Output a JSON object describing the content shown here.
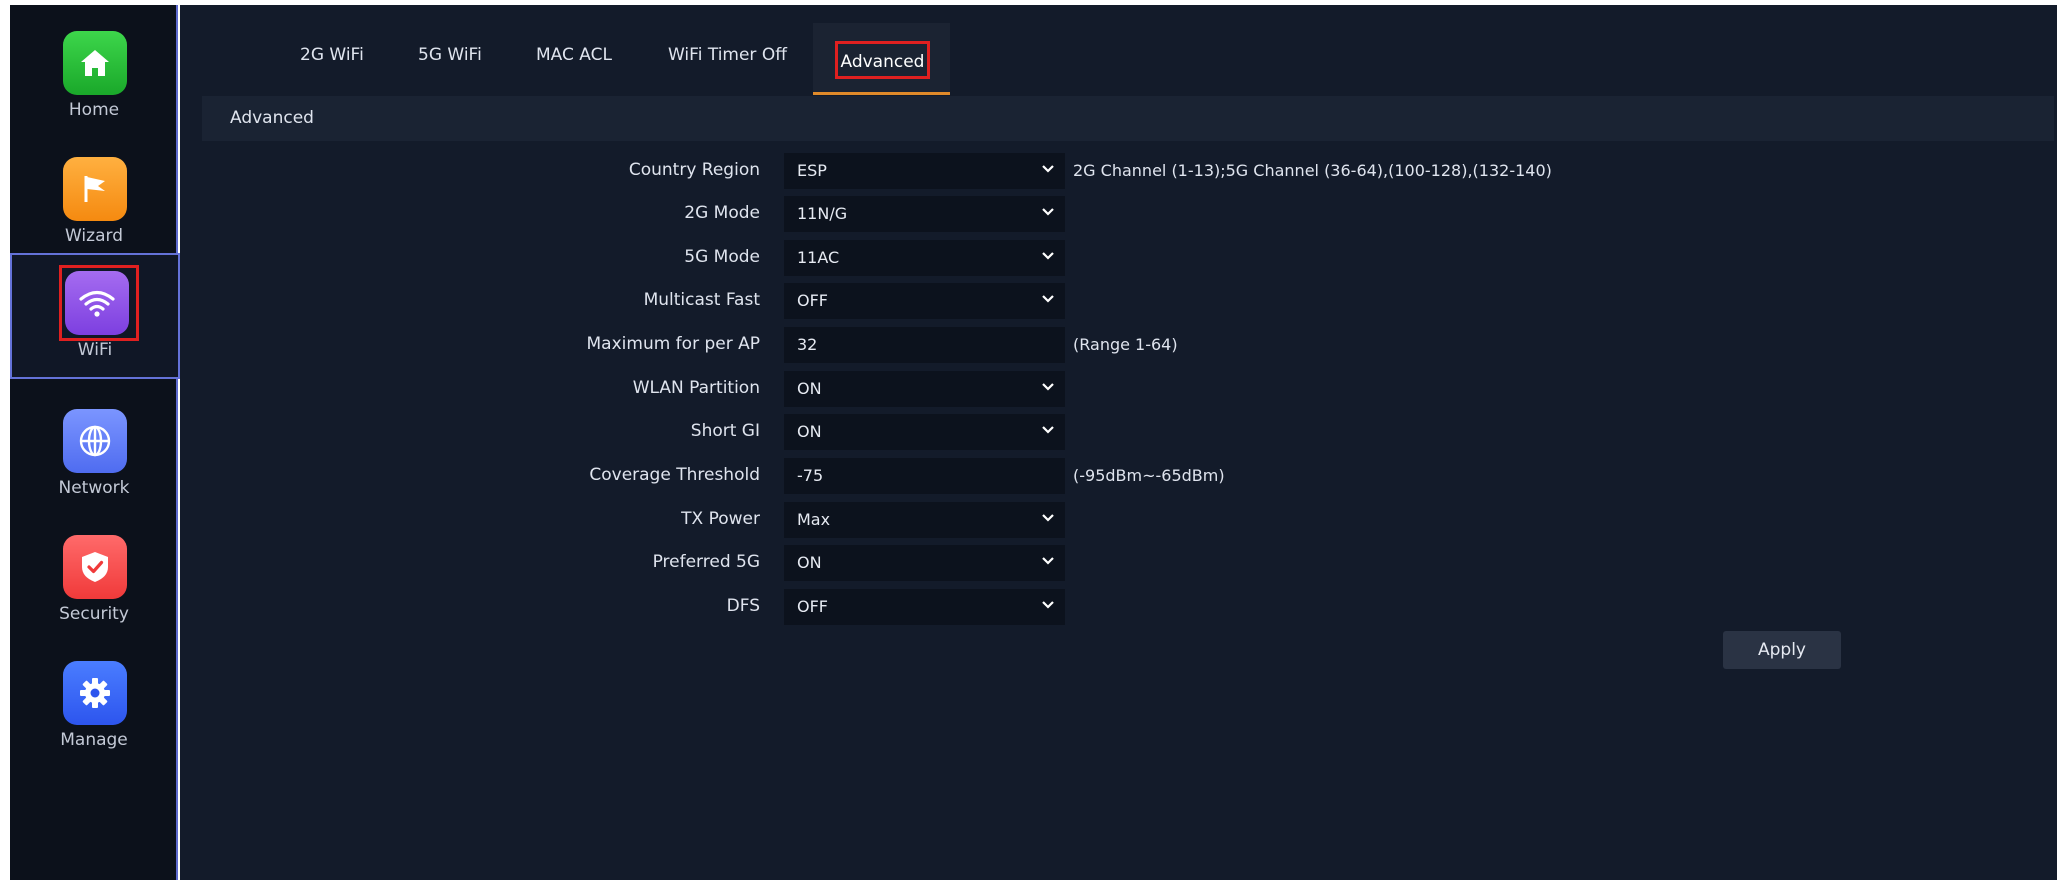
{
  "sidebar": {
    "items": [
      {
        "label": "Home",
        "icon": "home-icon"
      },
      {
        "label": "Wizard",
        "icon": "flag-icon"
      },
      {
        "label": "WiFi",
        "icon": "wifi-icon"
      },
      {
        "label": "Network",
        "icon": "globe-icon"
      },
      {
        "label": "Security",
        "icon": "shield-icon"
      },
      {
        "label": "Manage",
        "icon": "gear-icon"
      }
    ],
    "active": "WiFi"
  },
  "tabs": {
    "items": [
      "2G WiFi",
      "5G WiFi",
      "MAC ACL",
      "WiFi Timer Off",
      "Advanced"
    ],
    "active": "Advanced"
  },
  "section": {
    "title": "Advanced"
  },
  "form": {
    "rows": [
      {
        "label": "Country Region",
        "value": "ESP",
        "type": "select",
        "hint": "2G Channel (1-13);5G Channel (36-64),(100-128),(132-140)"
      },
      {
        "label": "2G Mode",
        "value": "11N/G",
        "type": "select",
        "hint": ""
      },
      {
        "label": "5G Mode",
        "value": "11AC",
        "type": "select",
        "hint": ""
      },
      {
        "label": "Multicast Fast",
        "value": "OFF",
        "type": "select",
        "hint": ""
      },
      {
        "label": "Maximum for per AP",
        "value": "32",
        "type": "input",
        "hint": "(Range 1-64)"
      },
      {
        "label": "WLAN Partition",
        "value": "ON",
        "type": "select",
        "hint": ""
      },
      {
        "label": "Short GI",
        "value": "ON",
        "type": "select",
        "hint": ""
      },
      {
        "label": "Coverage Threshold",
        "value": "-75",
        "type": "input",
        "hint": "(-95dBm~-65dBm)"
      },
      {
        "label": "TX Power",
        "value": "Max",
        "type": "select",
        "hint": ""
      },
      {
        "label": "Preferred 5G",
        "value": "ON",
        "type": "select",
        "hint": ""
      },
      {
        "label": "DFS",
        "value": "OFF",
        "type": "select",
        "hint": ""
      }
    ],
    "apply_label": "Apply"
  },
  "colors": {
    "background": "#131b2a",
    "sidebar": "#0c111b",
    "highlight": "#e02020",
    "tab_underline": "#e08a2a"
  }
}
